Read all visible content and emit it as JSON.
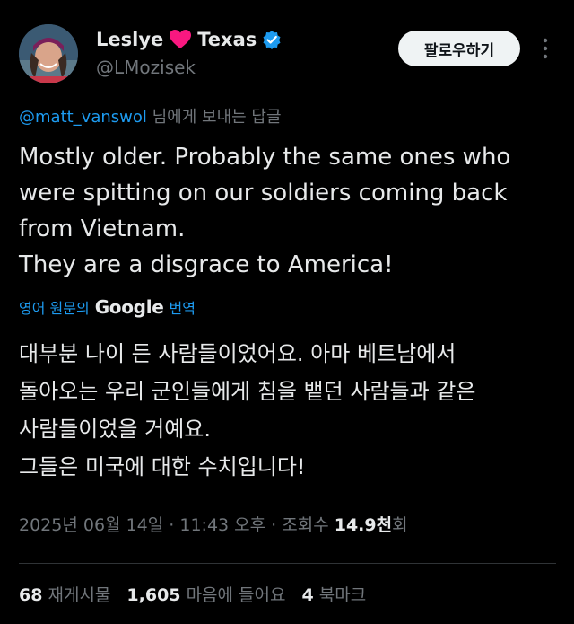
{
  "author": {
    "display_name_part1": "Leslye",
    "display_name_part2": "Texas",
    "handle": "@LMozisek",
    "heart_icon": "heart-icon",
    "verified_icon": "verified-badge-icon",
    "verified_color": "#1d9bf0"
  },
  "actions": {
    "follow_label": "팔로우하기",
    "more_icon": "more-vertical-icon"
  },
  "reply": {
    "mention": "@matt_vanswol",
    "suffix": " 님에게 보내는 답글"
  },
  "tweet": {
    "text": "Mostly older. Probably the same ones who\nwere spitting on our soldiers coming back\nfrom Vietnam.\nThey are a disgrace to America!"
  },
  "translation": {
    "prefix": "영어 원문의",
    "google": "Google",
    "suffix": "번역",
    "text": "대부분 나이 든 사람들이었어요. 아마 베트남에서\n돌아오는 우리 군인들에게 침을 뱉던 사람들과 같은\n사람들이었을 거예요.\n그들은 미국에 대한 수치입니다!"
  },
  "meta": {
    "date": "2025년 06월 14일",
    "sep1": " · ",
    "time": "11:43 오후",
    "sep2": " · ",
    "views_label": "조회수 ",
    "views_count": "14.9천",
    "views_unit": "회"
  },
  "stats": {
    "reposts_count": "68",
    "reposts_label": " 재게시물",
    "likes_count": "1,605",
    "likes_label": " 마음에 들어요",
    "bookmarks_count": "4",
    "bookmarks_label": " 북마크"
  },
  "colors": {
    "background": "#000000",
    "text": "#e7e9ea",
    "secondary": "#71767b",
    "link": "#1d9bf0",
    "heart": "#f91880"
  }
}
